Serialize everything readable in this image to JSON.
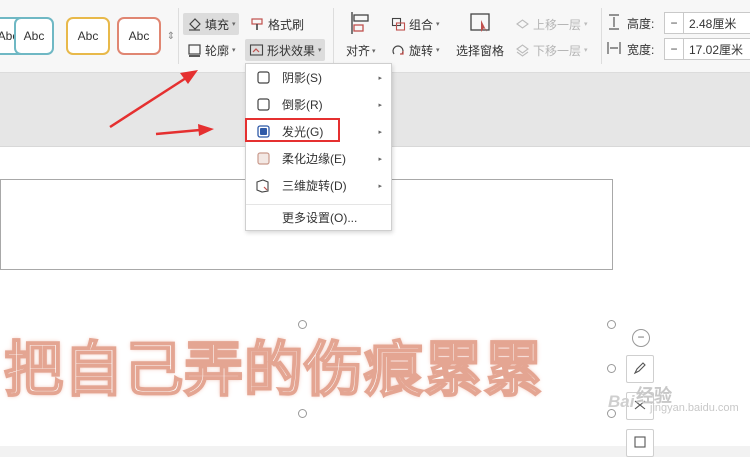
{
  "ribbon": {
    "style_swatches": [
      {
        "label": "Abc",
        "border": "#6fb8c4"
      },
      {
        "label": "Abc",
        "border": "#6cc29a"
      },
      {
        "label": "Abc",
        "border": "#e8b94a"
      },
      {
        "label": "Abc",
        "border": "#e08672"
      }
    ],
    "fill_label": "填充",
    "format_painter_label": "格式刷",
    "outline_label": "轮廓",
    "shape_effects_label": "形状效果",
    "align_label": "对齐",
    "group_label": "组合",
    "rotate_label": "旋转",
    "selection_pane_label": "选择窗格",
    "bring_forward_label": "上移一层",
    "send_backward_label": "下移一层",
    "height_label": "高度:",
    "height_value": "2.48厘米",
    "width_label": "宽度:",
    "width_value": "17.02厘米",
    "minus": "−"
  },
  "menu": {
    "items": [
      {
        "label": "阴影(S)",
        "has_submenu": true
      },
      {
        "label": "倒影(R)",
        "has_submenu": true
      },
      {
        "label": "发光(G)",
        "has_submenu": true
      },
      {
        "label": "柔化边缘(E)",
        "has_submenu": true
      },
      {
        "label": "三维旋转(D)",
        "has_submenu": true
      }
    ],
    "more_settings": "更多设置(O)..."
  },
  "slide": {
    "text": "把自己弄的伤痕累累"
  },
  "watermark": {
    "brand": "经验",
    "site": "jingyan.baidu.com",
    "logo": "Bai"
  },
  "colors": {
    "highlight": "#e53030",
    "arrow": "#e53030",
    "text_stroke": "#e4a592"
  }
}
